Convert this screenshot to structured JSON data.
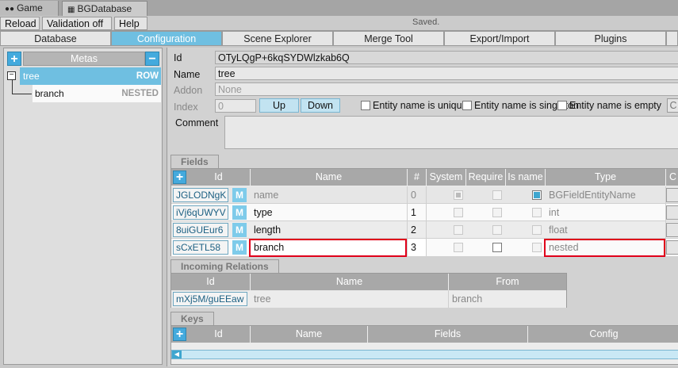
{
  "window_tabs": [
    {
      "label": "Game",
      "icon": "gamepad-icon"
    },
    {
      "label": "BGDatabase",
      "icon": "database-icon"
    }
  ],
  "toolbar": {
    "reload": "Reload",
    "validation": "Validation off",
    "help": "Help",
    "status": "Saved."
  },
  "main_tabs": [
    "Database",
    "Configuration",
    "Scene Explorer",
    "Merge Tool",
    "Export/Import",
    "Plugins"
  ],
  "metas": {
    "header": "Metas",
    "add": "+",
    "remove": "−",
    "items": [
      {
        "name": "tree",
        "kind": "ROW"
      },
      {
        "name": "branch",
        "kind": "NESTED"
      }
    ]
  },
  "meta_detail": {
    "id_label": "Id",
    "id_value": "OTyLQgP+6kqSYDWlzkab6Q",
    "name_label": "Name",
    "name_value": "tree",
    "addon_label": "Addon",
    "addon_value": "None",
    "index_label": "Index",
    "index_value": "0",
    "up": "Up",
    "down": "Down",
    "unique": "Entity name is unique",
    "singleton": "Entity name is singleton",
    "empty": "Entity name is empty",
    "cut_button": "C",
    "comment_label": "Comment",
    "comment_value": ""
  },
  "fields": {
    "section": "Fields",
    "add": "+",
    "columns": [
      "Id",
      "Name",
      "#",
      "System",
      "Require",
      "Is name",
      "Type",
      "C"
    ],
    "rows": [
      {
        "id": "JGLODNgK",
        "m": "M",
        "name": "name",
        "index": "0",
        "type": "BGFieldEntityName"
      },
      {
        "id": "iVj6qUWYV",
        "m": "M",
        "name": "type",
        "index": "1",
        "type": "int"
      },
      {
        "id": "8uiGUEur6",
        "m": "M",
        "name": "length",
        "index": "2",
        "type": "float"
      },
      {
        "id": "sCxETL58",
        "m": "M",
        "name": "branch",
        "index": "3",
        "type": "nested"
      }
    ]
  },
  "incoming": {
    "section": "Incoming Relations",
    "columns": [
      "Id",
      "Name",
      "From"
    ],
    "rows": [
      {
        "id": "mXj5M/guEEaw",
        "name": "tree",
        "from": "branch"
      }
    ]
  },
  "keys": {
    "section": "Keys",
    "add": "+",
    "columns": [
      "Id",
      "Name",
      "Fields",
      "Config"
    ]
  },
  "colors": {
    "accent": "#6fbfe1",
    "highlight": "#e0001a"
  }
}
